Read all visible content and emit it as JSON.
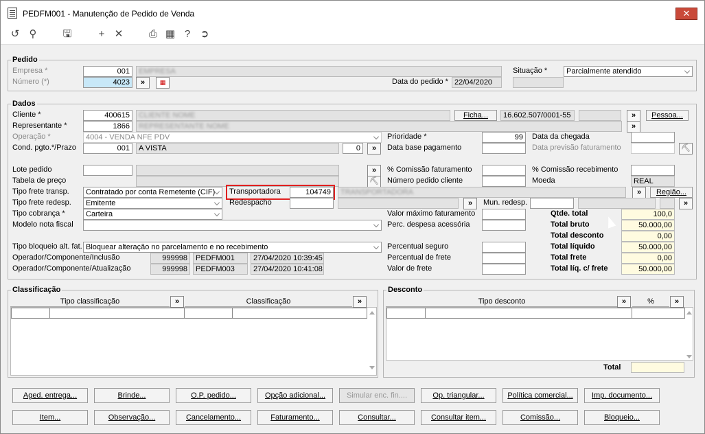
{
  "window": {
    "title": "PEDFM001 - Manutenção de Pedido de Venda",
    "close_label": "✕"
  },
  "toolbar": {
    "icons": [
      "undo-icon",
      "search-icon",
      "save-icon",
      "add-icon",
      "delete-icon",
      "print-icon",
      "calendar-icon",
      "help-icon",
      "exit-icon"
    ]
  },
  "pedido": {
    "title": "Pedido",
    "empresa_label": "Empresa *",
    "empresa_value": "001",
    "numero_label": "Número (*)",
    "numero_value": "4023",
    "situacao_label": "Situação *",
    "situacao_value": "Parcialmente atendido",
    "data_label": "Data do pedido *",
    "data_value": "22/04/2020"
  },
  "dados": {
    "title": "Dados",
    "cliente_label": "Cliente *",
    "cliente_value": "400615",
    "ficha_label": "Ficha...",
    "cnpj_value": "16.602.507/0001-55",
    "pessoa_label": "Pessoa...",
    "representante_label": "Representante *",
    "representante_value": "1866",
    "operacao_label": "Operação *",
    "operacao_value": "4004 - VENDA NFE PDV",
    "cond_label": "Cond. pgto.*/Prazo",
    "cond_value": "001",
    "cond_desc": "A VISTA",
    "prazo_value": "0",
    "prioridade_label": "Prioridade *",
    "prioridade_value": "99",
    "data_chegada_label": "Data da chegada",
    "data_base_label": "Data base pagamento",
    "data_prev_label": "Data previsão faturamento",
    "lote_label": "Lote pedido",
    "tabela_label": "Tabela de preço",
    "comissao_fat_label": "% Comissão faturamento",
    "comissao_rec_label": "% Comissão recebimento",
    "num_pedido_cli_label": "Número pedido cliente",
    "moeda_label": "Moeda",
    "moeda_value": "REAL",
    "tipo_frete_label": "Tipo frete transp.",
    "tipo_frete_value": "Contratado por conta Remetente (CIF)",
    "transportadora_label": "Transportadora",
    "transportadora_value": "104749",
    "regiao_label": "Região...",
    "tipo_frete_redesp_label": "Tipo frete redesp.",
    "tipo_frete_redesp_value": "Emitente",
    "redespacho_label": "Redespacho",
    "mun_redesp_label": "Mun. redesp.",
    "tipo_cobranca_label": "Tipo cobrança *",
    "tipo_cobranca_value": "Carteira",
    "modelo_nf_label": "Modelo nota fiscal",
    "valor_max_label": "Valor máximo faturamento",
    "perc_desp_label": "Perc. despesa acessória",
    "tipo_bloqueio_label": "Tipo bloqueio alt. fat.",
    "tipo_bloqueio_value": "Bloquear alteração no parcelamento e no recebimento",
    "op_inclusao_label": "Operador/Componente/Inclusão",
    "op_inclusao_op": "999998",
    "op_inclusao_comp": "PEDFM001",
    "op_inclusao_dt": "27/04/2020 10:39:45",
    "op_atual_label": "Operador/Componente/Atualização",
    "op_atual_op": "999998",
    "op_atual_comp": "PEDFM003",
    "op_atual_dt": "27/04/2020 10:41:08",
    "perc_seguro_label": "Percentual seguro",
    "perc_frete_label": "Percentual de frete",
    "valor_frete_label": "Valor de frete",
    "qtde_total_label": "Qtde. total",
    "qtde_total_value": "100,0",
    "total_bruto_label": "Total bruto",
    "total_bruto_value": "50.000,00",
    "total_desc_label": "Total desconto",
    "total_desc_value": "0,00",
    "total_liq_label": "Total líquido",
    "total_liq_value": "50.000,00",
    "total_frete_label": "Total frete",
    "total_frete_value": "0,00",
    "total_liq_frete_label": "Total líq. c/ frete",
    "total_liq_frete_value": "50.000,00"
  },
  "classificacao": {
    "title": "Classificação",
    "col1": "Tipo classificação",
    "col2": "Classificação"
  },
  "desconto": {
    "title": "Desconto",
    "col1": "Tipo desconto",
    "col2": "%",
    "total_label": "Total"
  },
  "buttons_row1": [
    "Aged. entrega...",
    "Brinde...",
    "O.P. pedido...",
    "Opção adicional...",
    "Simular enc. fin....",
    "Op. triangular...",
    "Política comercial...",
    "Imp. documento..."
  ],
  "buttons_row2": [
    "Item...",
    "Observação...",
    "Cancelamento...",
    "Faturamento...",
    "Consultar...",
    "Consultar item...",
    "Comissão...",
    "Bloqueio..."
  ],
  "arrow": "»"
}
